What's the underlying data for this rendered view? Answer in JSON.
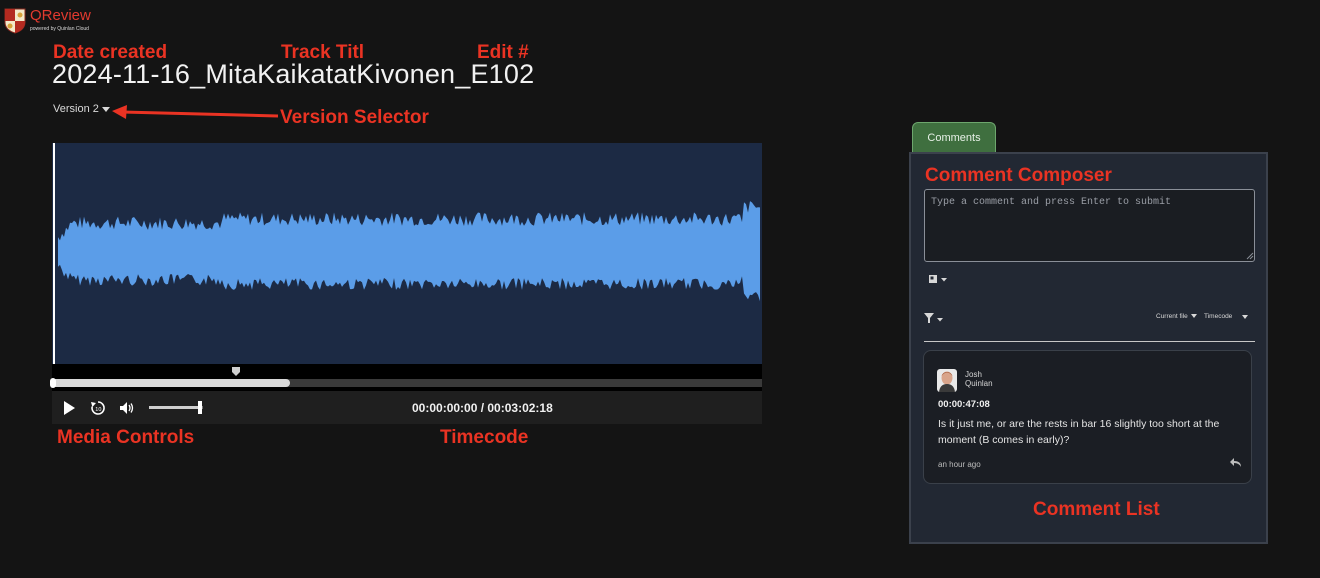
{
  "app": {
    "name": "QReview",
    "tagline": "powered by Quinlan Cloud",
    "brand_color": "#e23a2f"
  },
  "annotations": {
    "date_created": "Date created",
    "track_title": "Track Titl",
    "edit_number": "Edit #",
    "version_selector": "Version Selector",
    "media_controls": "Media Controls",
    "timecode": "Timecode",
    "comment_composer": "Comment Composer",
    "comment_list": "Comment List",
    "color": "#ea3323"
  },
  "track": {
    "title": "2024-11-16_MitaKaikatatKivonen_E102",
    "version": "Version 2"
  },
  "player": {
    "timecode": "00:00:00:00 / 00:03:02:18",
    "progress_buffered": 0.335,
    "progress_played": 0,
    "volume": 0.95,
    "waveform_color": "#5b9de8",
    "waveform_bg": "#1c2a44"
  },
  "comments_panel": {
    "tab_label": "Comments",
    "tab_color": "#3f6f3f",
    "composer_placeholder": "Type a comment and press Enter to submit",
    "scope_filter": "Current file",
    "sort": "Timecode",
    "comments": [
      {
        "author_first": "Josh",
        "author_last": "Quinlan",
        "timecode": "00:00:47:08",
        "text": "Is it just me, or are the rests in bar 16 slightly too short at the moment (B comes in early)?",
        "posted": "an hour ago"
      }
    ]
  }
}
